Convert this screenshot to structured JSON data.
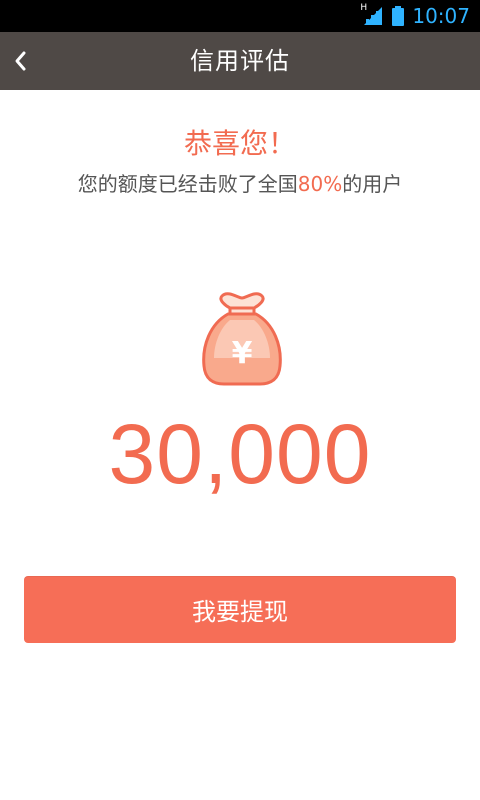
{
  "status_bar": {
    "network_type": "H",
    "time": "10:07",
    "icons": [
      "signal-icon",
      "battery-icon"
    ]
  },
  "app_bar": {
    "title": "信用评估",
    "back_icon": "chevron-left-icon"
  },
  "result": {
    "congrats": "恭喜您！",
    "subtitle_before": "您的额度已经击败了全国",
    "percent": "80%",
    "subtitle_after": "的用户",
    "bag_icon": "money-bag-icon",
    "currency_symbol": "¥",
    "amount": "30,000"
  },
  "actions": {
    "withdraw_label": "我要提现"
  },
  "colors": {
    "accent": "#f26b50",
    "button": "#f66e57",
    "app_bar": "#4f4946",
    "status_bar": "#000000",
    "clock": "#2fb3ff",
    "bag_fill": "#f9a98c"
  }
}
